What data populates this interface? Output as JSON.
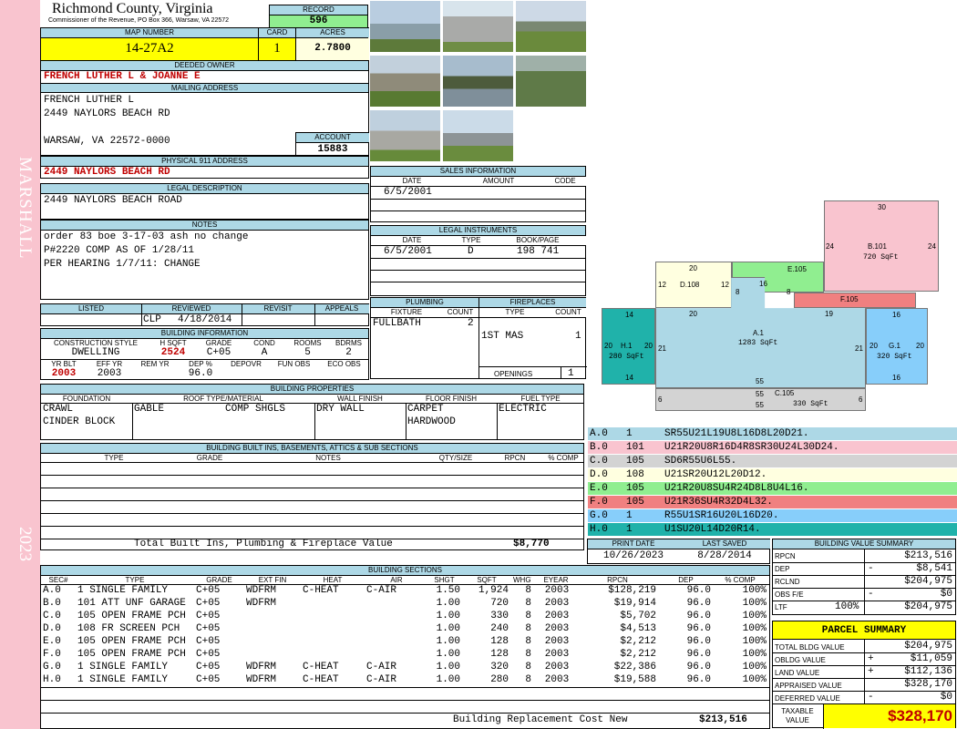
{
  "sidebar": {
    "district": "MARSHALL",
    "year": "2023",
    "color": "#f9c4cf"
  },
  "header": {
    "county": "Richmond County, Virginia",
    "subtitle": "Commissioner of the Revenue, PO Box 366, Warsaw, VA 22572",
    "record_label": "RECORD",
    "record": "596",
    "map_label": "MAP NUMBER",
    "map_number": "14-27A2",
    "card_label": "CARD",
    "card": "1",
    "acres_label": "ACRES",
    "acres": "2.7800"
  },
  "owner": {
    "deeded_label": "DEEDED OWNER",
    "deeded_owner": "FRENCH LUTHER L & JOANNE E",
    "mailing_label": "MAILING ADDRESS",
    "mail_line1": "FRENCH LUTHER L",
    "mail_line2": "2449 NAYLORS BEACH RD",
    "mail_line3": "WARSAW, VA 22572-0000",
    "account_label": "ACCOUNT",
    "account": "15883"
  },
  "physical": {
    "label": "PHYSICAL 911 ADDRESS",
    "address": "2449 NAYLORS BEACH RD"
  },
  "legal": {
    "label": "LEGAL DESCRIPTION",
    "text": "2449 NAYLORS BEACH ROAD"
  },
  "notes": {
    "label": "NOTES",
    "line1": "order 83 boe 3-17-03 ash no change",
    "line2": "P#2220 COMP AS OF 1/28/11",
    "line3": "PER HEARING 1/7/11: CHANGE"
  },
  "sales": {
    "label": "SALES INFORMATION",
    "h_date": "DATE",
    "h_amount": "AMOUNT",
    "h_code": "CODE",
    "date": "6/5/2001"
  },
  "instruments": {
    "label": "LEGAL INSTRUMENTS",
    "h_date": "DATE",
    "h_type": "TYPE",
    "h_book": "BOOK/PAGE",
    "date": "6/5/2001",
    "type": "D",
    "book": "198 741"
  },
  "plumbing": {
    "label": "PLUMBING",
    "h_fixture": "FIXTURE",
    "h_count": "COUNT",
    "fixture": "FULLBATH",
    "count": "2"
  },
  "fireplaces": {
    "label": "FIREPLACES",
    "h_type": "TYPE",
    "h_count": "COUNT",
    "type": "1ST MAS",
    "count": "1",
    "openings_label": "OPENINGS",
    "openings": "1"
  },
  "review": {
    "h_listed": "LISTED",
    "h_reviewed": "REVIEWED",
    "h_revisit": "REVISIT",
    "h_appeals": "APPEALS",
    "reviewer": "CLP",
    "reviewed": "4/18/2014"
  },
  "building_info": {
    "label": "BUILDING INFORMATION",
    "h_style": "CONSTRUCTION STYLE",
    "h_hsqft": "H SQFT",
    "h_grade": "GRADE",
    "h_cond": "COND",
    "h_rooms": "ROOMS",
    "h_bdrms": "BDRMS",
    "style": "DWELLING",
    "hsqft": "2524",
    "grade": "C+05",
    "cond": "A",
    "rooms": "5",
    "bdrms": "2",
    "h_yrblt": "YR BLT",
    "h_effyr": "EFF YR",
    "h_remyr": "REM YR",
    "h_dep": "DEP %",
    "h_depovr": "DEPOVR",
    "h_funobs": "FUN OBS",
    "h_ecoobs": "ECO OBS",
    "yrblt": "2003",
    "effyr": "2003",
    "dep": "96.0"
  },
  "properties": {
    "label": "BUILDING PROPERTIES",
    "h_foundation": "FOUNDATION",
    "h_roof": "ROOF TYPE/MATERIAL",
    "h_wall": "WALL FINISH",
    "h_floor": "FLOOR FINISH",
    "h_fuel": "FUEL TYPE",
    "foundation1": "CRAWL",
    "foundation2": "CINDER BLOCK",
    "roof_type": "GABLE",
    "roof_mat": "COMP SHGLS",
    "wall": "DRY WALL",
    "floor1": "CARPET",
    "floor2": "HARDWOOD",
    "fuel": "ELECTRIC"
  },
  "builtins": {
    "label": "BUILDING BUILT INS, BASEMENTS, ATTICS & SUB SECTIONS",
    "h_type": "TYPE",
    "h_grade": "GRADE",
    "h_notes": "NOTES",
    "h_qty": "QTY/SIZE",
    "h_rpcn": "RPCN",
    "h_comp": "% COMP",
    "total_label": "Total Built Ins, Plumbing & Fireplace Value",
    "total": "$8,770"
  },
  "print": {
    "h_print": "PRINT DATE",
    "h_saved": "LAST SAVED",
    "print_date": "10/26/2023",
    "last_saved": "8/28/2014"
  },
  "sections": {
    "label": "BUILDING SECTIONS",
    "headers": [
      "SEC#",
      "TYPE",
      "GRADE",
      "EXT FIN",
      "HEAT",
      "AIR",
      "SHGT",
      "SQFT",
      "WHGT",
      "EYEAR",
      "RPCN",
      "DEP",
      "% COMP"
    ],
    "rows": [
      [
        "A.0",
        "1 SINGLE FAMILY",
        "C+05",
        "WDFRM",
        "C-HEAT",
        "C-AIR",
        "1.50",
        "1,924",
        "8",
        "2003",
        "$128,219",
        "96.0",
        "100%"
      ],
      [
        "B.0",
        "101 ATT UNF GARAGE",
        "C+05",
        "WDFRM",
        "",
        "",
        "1.00",
        "720",
        "8",
        "2003",
        "$19,914",
        "96.0",
        "100%"
      ],
      [
        "C.0",
        "105 OPEN FRAME PCH",
        "C+05",
        "",
        "",
        "",
        "1.00",
        "330",
        "8",
        "2003",
        "$5,702",
        "96.0",
        "100%"
      ],
      [
        "D.0",
        "108 FR SCREEN PCH",
        "C+05",
        "",
        "",
        "",
        "1.00",
        "240",
        "8",
        "2003",
        "$4,513",
        "96.0",
        "100%"
      ],
      [
        "E.0",
        "105 OPEN FRAME PCH",
        "C+05",
        "",
        "",
        "",
        "1.00",
        "128",
        "8",
        "2003",
        "$2,212",
        "96.0",
        "100%"
      ],
      [
        "F.0",
        "105 OPEN FRAME PCH",
        "C+05",
        "",
        "",
        "",
        "1.00",
        "128",
        "8",
        "2003",
        "$2,212",
        "96.0",
        "100%"
      ],
      [
        "G.0",
        "1 SINGLE FAMILY",
        "C+05",
        "WDFRM",
        "C-HEAT",
        "C-AIR",
        "1.00",
        "320",
        "8",
        "2003",
        "$22,386",
        "96.0",
        "100%"
      ],
      [
        "H.0",
        "1 SINGLE FAMILY",
        "C+05",
        "WDFRM",
        "C-HEAT",
        "C-AIR",
        "1.00",
        "280",
        "8",
        "2003",
        "$19,588",
        "96.0",
        "100%"
      ]
    ],
    "brcn_label": "Building Replacement Cost New",
    "brcn": "$213,516"
  },
  "segments": [
    {
      "sec": "A.0",
      "code": "1",
      "path": "SR55U21L19U8L16D8L20D21.",
      "color": "#add8e6"
    },
    {
      "sec": "B.0",
      "code": "101",
      "path": "U21R20U8R16D4R8SR30U24L30D24.",
      "color": "#f9c4cf"
    },
    {
      "sec": "C.0",
      "code": "105",
      "path": "SD6R55U6L55.",
      "color": "#d3d3d3"
    },
    {
      "sec": "D.0",
      "code": "108",
      "path": "U21SR20U12L20D12.",
      "color": "#ffffe0"
    },
    {
      "sec": "E.0",
      "code": "105",
      "path": "U21R20U8SU4R24D8L8U4L16.",
      "color": "#90ee90"
    },
    {
      "sec": "F.0",
      "code": "105",
      "path": "U21R36SU4R32D4L32.",
      "color": "#f08080"
    },
    {
      "sec": "G.0",
      "code": "1",
      "path": "R55U1SR16U20L16D20.",
      "color": "#87cefa"
    },
    {
      "sec": "H.0",
      "code": "1",
      "path": "U1SU20L14D20R14.",
      "color": "#20b2aa"
    }
  ],
  "sketch": {
    "b_label": "B.101",
    "b_area": "720 SqFt",
    "b_top": "30",
    "b_left": "24",
    "b_right": "24",
    "a_label": "A.1",
    "a_area": "1283 SqFt",
    "e_label": "E.105",
    "f_label": "F.105",
    "d_label": "D.108",
    "h_label": "H.1",
    "h_area": "280 SqFt",
    "g_label": "G.1",
    "g_area": "320 SqFt",
    "c_label": "C.105",
    "c_area": "330 SqFt",
    "n20a": "20",
    "n12a": "12",
    "n12b": "12",
    "n16a": "16",
    "n8a": "8",
    "n8b": "8",
    "n20b": "20",
    "n19": "19",
    "n14a": "14",
    "n16b": "16",
    "n20h1": "20",
    "n20h2": "20",
    "n21a": "21",
    "n21b": "21",
    "n20g1": "20",
    "n20g2": "20",
    "n14b": "14",
    "n16c": "16",
    "n55a": "55",
    "n55b": "55",
    "n55c": "55",
    "n6a": "6",
    "n6b": "6"
  },
  "value_summary": {
    "label": "BUILDING VALUE SUMMARY",
    "rpcn_label": "RPCN",
    "rpcn": "$213,516",
    "dep_label": "DEP",
    "dep_sign": "-",
    "dep": "$8,541",
    "rclnd_label": "RCLND",
    "rclnd": "$204,975",
    "obs_label": "OBS F/E",
    "obs_sign": "-",
    "obs": "$0",
    "ltf_label": "LTF",
    "ltf_pct": "100%",
    "ltf": "$204,975"
  },
  "parcel": {
    "label": "PARCEL SUMMARY",
    "tbv_label": "TOTAL BLDG VALUE",
    "tbv": "$204,975",
    "oblg_label": "OBLDG VALUE",
    "oblg_sign": "+",
    "oblg": "$11,059",
    "land_label": "LAND VALUE",
    "land_sign": "+",
    "land": "$112,136",
    "appr_label": "APPRAISED VALUE",
    "appr": "$328,170",
    "def_label": "DEFERRED VALUE",
    "def_sign": "-",
    "def": "$0",
    "tax_label1": "TAXABLE",
    "tax_label2": "VALUE",
    "tax": "$328,170"
  }
}
